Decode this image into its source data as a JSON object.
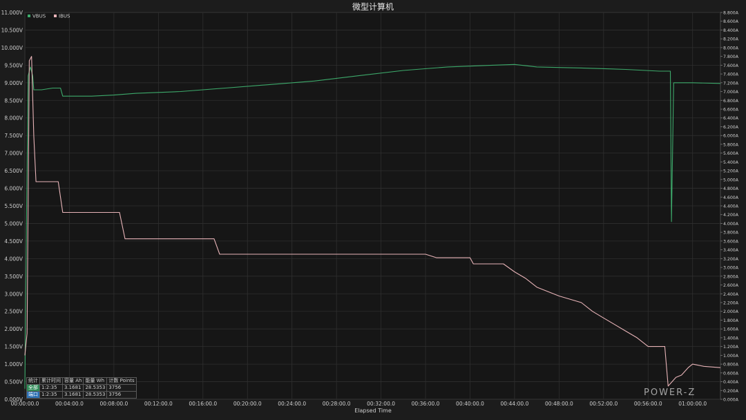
{
  "chart_data": {
    "type": "line",
    "title": "微型计算机",
    "xlabel": "Elapsed Time",
    "x_unit": "minutes",
    "xlim": [
      0,
      62.5
    ],
    "x_ticks": [
      "00:00:00.0",
      "00:04:00.0",
      "00:08:00.0",
      "00:12:00.0",
      "00:16:00.0",
      "00:20:00.0",
      "00:24:00.0",
      "00:28:00.0",
      "00:32:00.0",
      "00:36:00.0",
      "00:40:00.0",
      "00:44:00.0",
      "00:48:00.0",
      "00:52:00.0",
      "00:56:00.0",
      "01:00:00.0"
    ],
    "y_left": {
      "lim": [
        0,
        11
      ],
      "ticks": [
        "0.000V",
        "0.500V",
        "1.000V",
        "1.500V",
        "2.000V",
        "2.500V",
        "3.000V",
        "3.500V",
        "4.000V",
        "4.500V",
        "5.000V",
        "5.500V",
        "6.000V",
        "6.500V",
        "7.000V",
        "7.500V",
        "8.000V",
        "8.500V",
        "9.000V",
        "9.500V",
        "10.000V",
        "10.500V",
        "11.000V"
      ]
    },
    "y_right": {
      "lim": [
        0,
        8.8
      ],
      "ticks": [
        "0.000A",
        "0.200A",
        "0.400A",
        "0.600A",
        "0.800A",
        "1.000A",
        "1.200A",
        "1.400A",
        "1.600A",
        "1.800A",
        "2.000A",
        "2.200A",
        "2.400A",
        "2.600A",
        "2.800A",
        "3.000A",
        "3.200A",
        "3.400A",
        "3.600A",
        "3.800A",
        "4.000A",
        "4.200A",
        "4.400A",
        "4.600A",
        "4.800A",
        "5.000A",
        "5.200A",
        "5.400A",
        "5.600A",
        "5.800A",
        "6.000A",
        "6.200A",
        "6.400A",
        "6.600A",
        "6.800A",
        "7.000A",
        "7.200A",
        "7.400A",
        "7.600A",
        "7.800A",
        "8.000A",
        "8.200A",
        "8.400A",
        "8.600A",
        "8.800A"
      ]
    },
    "legend_position": "top-left",
    "grid": true,
    "series": [
      {
        "name": "VBUS",
        "axis": "left",
        "color": "#3daa6b",
        "points": [
          [
            0,
            0.3
          ],
          [
            0.15,
            5.2
          ],
          [
            0.3,
            9.2
          ],
          [
            0.5,
            9.45
          ],
          [
            0.7,
            9.2
          ],
          [
            0.8,
            8.8
          ],
          [
            1.5,
            8.8
          ],
          [
            2.5,
            8.85
          ],
          [
            3.2,
            8.85
          ],
          [
            3.4,
            8.62
          ],
          [
            6,
            8.62
          ],
          [
            8,
            8.65
          ],
          [
            10,
            8.7
          ],
          [
            14,
            8.75
          ],
          [
            18,
            8.85
          ],
          [
            22,
            8.95
          ],
          [
            26,
            9.05
          ],
          [
            30,
            9.2
          ],
          [
            34,
            9.35
          ],
          [
            38,
            9.45
          ],
          [
            42,
            9.5
          ],
          [
            44,
            9.52
          ],
          [
            46,
            9.45
          ],
          [
            50,
            9.42
          ],
          [
            54,
            9.38
          ],
          [
            57,
            9.33
          ],
          [
            58,
            9.33
          ],
          [
            58.1,
            5.05
          ],
          [
            58.3,
            9.0
          ],
          [
            60,
            9.0
          ],
          [
            62.5,
            8.98
          ]
        ]
      },
      {
        "name": "IBUS",
        "axis": "right",
        "color": "#e8b4b8",
        "points": [
          [
            0,
            1.0
          ],
          [
            0.2,
            1.5
          ],
          [
            0.4,
            7.7
          ],
          [
            0.6,
            7.8
          ],
          [
            0.8,
            6.0
          ],
          [
            1.0,
            4.95
          ],
          [
            3.0,
            4.95
          ],
          [
            3.4,
            4.25
          ],
          [
            8.5,
            4.25
          ],
          [
            9,
            3.65
          ],
          [
            17,
            3.65
          ],
          [
            17.5,
            3.3
          ],
          [
            36,
            3.3
          ],
          [
            37,
            3.22
          ],
          [
            40,
            3.22
          ],
          [
            40.3,
            3.08
          ],
          [
            43,
            3.08
          ],
          [
            44,
            2.9
          ],
          [
            45,
            2.75
          ],
          [
            46,
            2.55
          ],
          [
            48,
            2.35
          ],
          [
            50,
            2.2
          ],
          [
            51,
            2.0
          ],
          [
            52,
            1.85
          ],
          [
            53,
            1.7
          ],
          [
            54,
            1.55
          ],
          [
            55,
            1.4
          ],
          [
            56,
            1.2
          ],
          [
            57.5,
            1.2
          ],
          [
            57.8,
            0.3
          ],
          [
            58.5,
            0.5
          ],
          [
            59,
            0.55
          ],
          [
            59.6,
            0.72
          ],
          [
            60,
            0.8
          ],
          [
            61,
            0.75
          ],
          [
            62.5,
            0.72
          ]
        ]
      }
    ]
  },
  "stats_table": {
    "headers": [
      "统计",
      "累计时间",
      "容量 Ah",
      "能量 Wh",
      "计数 Points"
    ],
    "rows": [
      {
        "tag": "全部",
        "time": "1:2:35",
        "ah": "3.1681",
        "wh": "28.5353",
        "points": "3756"
      },
      {
        "tag": "端口",
        "time": "1:2:35",
        "ah": "3.1681",
        "wh": "28.5353",
        "points": "3756"
      }
    ]
  },
  "watermark": "POWER-Z"
}
